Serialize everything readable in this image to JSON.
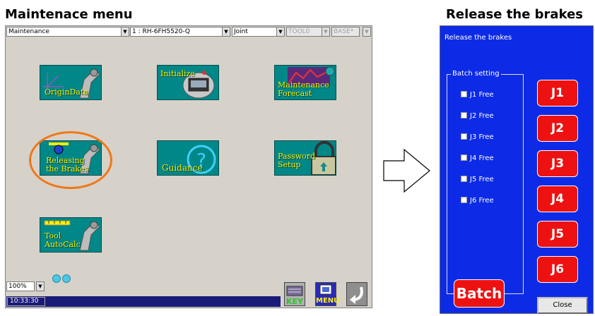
{
  "headings": {
    "left": "Maintenace menu",
    "right": "Release the brakes"
  },
  "toolbar": {
    "menu": "Maintenance",
    "robot": "1 : RH-6FH5520-Q",
    "jog_mode": "Joint",
    "tool": "TOOL0",
    "base": "BASE*"
  },
  "tiles": {
    "origin_data": [
      "OriginData"
    ],
    "initialize": [
      "Initialize"
    ],
    "maintenance_forecast": [
      "Maintenance",
      "Forecast"
    ],
    "releasing_brakes": [
      "Releasing",
      "the Brakes"
    ],
    "guidance": [
      "Guidance"
    ],
    "password_setup": [
      "Password",
      "Setup"
    ],
    "tool_autocalc": [
      "Tool",
      "AutoCalc"
    ]
  },
  "zoom": "100%",
  "time": "10:33:30",
  "bottom_buttons": {
    "key": "KEY",
    "menu": "MENU"
  },
  "brakes": {
    "title": "Release the brakes",
    "group_label": "Batch setting",
    "checkboxes": [
      "J1 Free",
      "J2 Free",
      "J3 Free",
      "J4 Free",
      "J5 Free",
      "J6 Free"
    ],
    "joints": [
      "J1",
      "J2",
      "J3",
      "J4",
      "J5",
      "J6"
    ],
    "batch": "Batch",
    "close": "Close"
  },
  "colors": {
    "tile": "#008787",
    "tile_text": "#ffef00",
    "highlight": "#f07818",
    "brake_panel": "#0d2be6",
    "joint_button": "#ee1111"
  },
  "icons": [
    "robot-arm-icon",
    "teaching-pendant-icon",
    "help-circle-icon",
    "padlock-icon",
    "ruler-icon",
    "return-arrow-icon",
    "keyboard-icon",
    "menu-grid-icon"
  ]
}
